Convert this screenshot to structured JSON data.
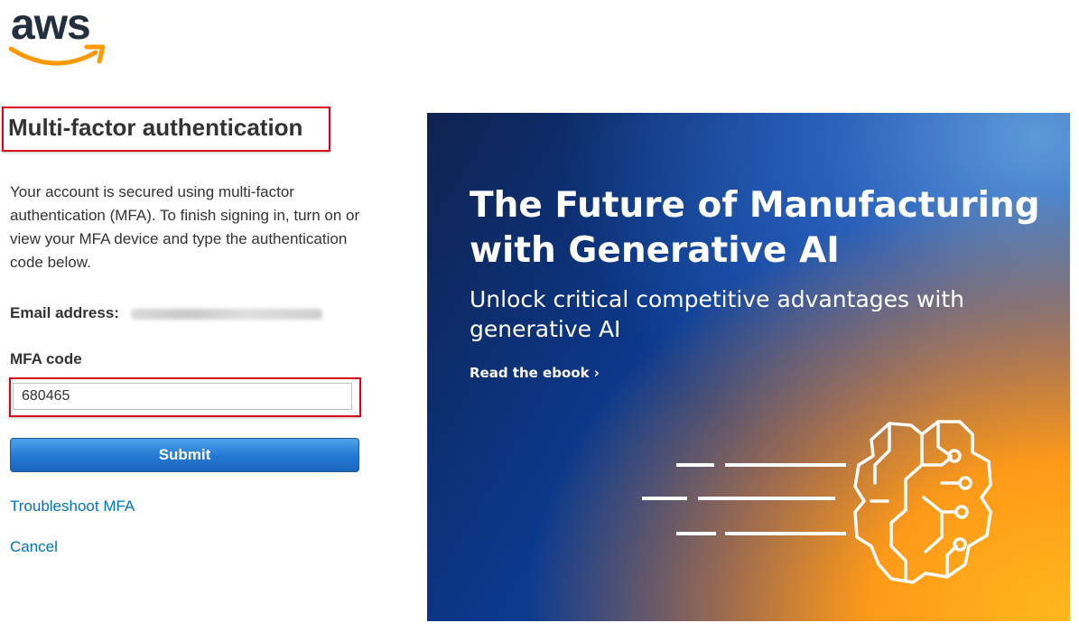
{
  "logo": {
    "text": "aws",
    "text_color": "#232f3e",
    "smile_color": "#ff9900"
  },
  "heading": "Multi-factor authentication",
  "description": "Your account is secured using multi-factor authentication (MFA). To finish signing in, turn on or view your MFA device and type the authentication code below.",
  "email": {
    "label": "Email address:",
    "value_blurred": true
  },
  "mfa": {
    "label": "MFA code",
    "value": "680465"
  },
  "submit_label": "Submit",
  "links": {
    "troubleshoot": "Troubleshoot MFA",
    "cancel": "Cancel"
  },
  "banner": {
    "title": "The Future of Manufacturing with Generative AI",
    "subtitle": "Unlock critical competitive advantages with generative AI",
    "cta": "Read the ebook ›",
    "art_icon": "brain-circuit-icon"
  },
  "colors": {
    "highlight_border": "#d9001b",
    "link": "#0073bb",
    "button": "#2378d2",
    "banner_orange": "#ffb81c",
    "banner_blue": "#0b3a8f"
  }
}
